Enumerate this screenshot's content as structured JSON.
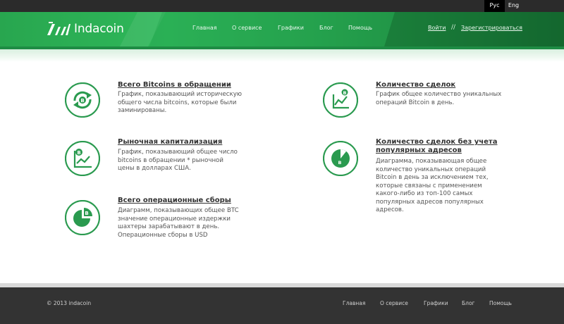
{
  "lang": {
    "ru": "Рус",
    "en": "Eng"
  },
  "brand": {
    "name": "Indacoin"
  },
  "nav": [
    "Главная",
    "О сервисе",
    "Графики",
    "Блог",
    "Помощь"
  ],
  "auth": {
    "login": "Войти",
    "separator": "//",
    "register": "Зарегистрироваться"
  },
  "items": [
    {
      "title": "Всего Bitcoins в обращении",
      "lines": [
        "График, показывающий историческую",
        "общего числа bitcoins, которые были",
        "заминированы."
      ]
    },
    {
      "title": "Рыночная капитализация",
      "lines": [
        "График, показывающий общее число",
        "bitcoins в обращении * рыночной",
        "цены в долларах США."
      ]
    },
    {
      "title": "Всего операционные сборы",
      "lines": [
        "Диаграмм, показывающих общее BTC",
        "значение операционные издержки",
        "шахтеры зарабатывают в день.",
        "Операционные сборы в USD"
      ]
    },
    {
      "title": "Количество сделок",
      "lines": [
        "График общее количество уникальных",
        "операций Bitcoin в день."
      ]
    },
    {
      "title_lines": [
        "Количество сделок без учета",
        "популярных адресов"
      ],
      "lines": [
        "Диаграмма, показывающая общее",
        "количество уникальных операций",
        "Bitcoin в день за исключением тех,",
        "которые связаны с применением",
        "какого-либо из топ-100 самых",
        "популярных адресов популярных",
        "адресов."
      ]
    }
  ],
  "icons": [
    "coin-cycle-icon",
    "chart-coin-icon",
    "pie-coin-icon",
    "chart-coin-icon",
    "pie-coin-icon"
  ],
  "footer": {
    "copyright": "© 2013 indacoin",
    "nav": [
      "Главная",
      "О сервисе",
      "Графики",
      "Блог",
      "Помощь"
    ]
  },
  "colors": {
    "accent": "#2aa052",
    "header_dark": "#176f34",
    "footer": "#333333"
  }
}
